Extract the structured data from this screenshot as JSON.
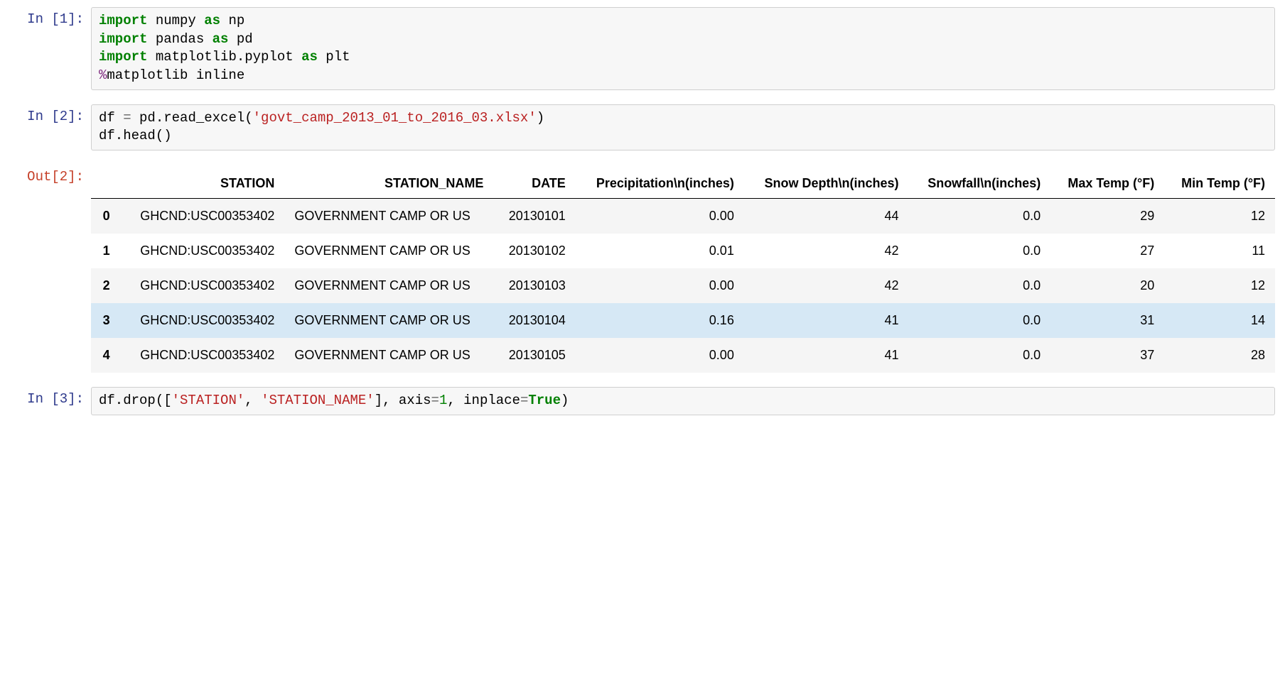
{
  "cells": {
    "c1": {
      "prompt": "In [1]:",
      "code": {
        "l1": {
          "kw1": "import",
          "m1": "numpy",
          "kw2": "as",
          "m2": "np"
        },
        "l2": {
          "kw1": "import",
          "m1": "pandas",
          "kw2": "as",
          "m2": "pd"
        },
        "l3": {
          "kw1": "import",
          "m1": "matplotlib.pyplot",
          "kw2": "as",
          "m2": "plt"
        },
        "l4": {
          "mag": "%",
          "txt": "matplotlib inline"
        }
      }
    },
    "c2": {
      "prompt": "In [2]:",
      "code": {
        "l1": {
          "lhs": "df ",
          "eq": "=",
          "fn": " pd.read_excel(",
          "str": "'govt_camp_2013_01_to_2016_03.xlsx'",
          "cl": ")"
        },
        "l2": {
          "txt": "df.head()"
        }
      }
    },
    "out2": {
      "prompt": "Out[2]:",
      "columns": [
        "STATION",
        "STATION_NAME",
        "DATE",
        "Precipitation\\n(inches)",
        "Snow Depth\\n(inches)",
        "Snowfall\\n(inches)",
        "Max Temp (°F)",
        "Min Temp (°F)"
      ],
      "rows": [
        {
          "idx": "0",
          "station": "GHCND:USC00353402",
          "name": "GOVERNMENT CAMP OR US",
          "date": "20130101",
          "prec": "0.00",
          "depth": "44",
          "snow": "0.0",
          "tmax": "29",
          "tmin": "12"
        },
        {
          "idx": "1",
          "station": "GHCND:USC00353402",
          "name": "GOVERNMENT CAMP OR US",
          "date": "20130102",
          "prec": "0.01",
          "depth": "42",
          "snow": "0.0",
          "tmax": "27",
          "tmin": "11"
        },
        {
          "idx": "2",
          "station": "GHCND:USC00353402",
          "name": "GOVERNMENT CAMP OR US",
          "date": "20130103",
          "prec": "0.00",
          "depth": "42",
          "snow": "0.0",
          "tmax": "20",
          "tmin": "12"
        },
        {
          "idx": "3",
          "station": "GHCND:USC00353402",
          "name": "GOVERNMENT CAMP OR US",
          "date": "20130104",
          "prec": "0.16",
          "depth": "41",
          "snow": "0.0",
          "tmax": "31",
          "tmin": "14",
          "hovered": true
        },
        {
          "idx": "4",
          "station": "GHCND:USC00353402",
          "name": "GOVERNMENT CAMP OR US",
          "date": "20130105",
          "prec": "0.00",
          "depth": "41",
          "snow": "0.0",
          "tmax": "37",
          "tmin": "28"
        }
      ]
    },
    "c3": {
      "prompt": "In [3]:",
      "code": {
        "l1": {
          "a": "df.drop([",
          "s1": "'STATION'",
          "b": ", ",
          "s2": "'STATION_NAME'",
          "c": "], axis",
          "eq1": "=",
          "n1": "1",
          "d": ", inplace",
          "eq2": "=",
          "tr": "True",
          "e": ")"
        }
      }
    }
  }
}
